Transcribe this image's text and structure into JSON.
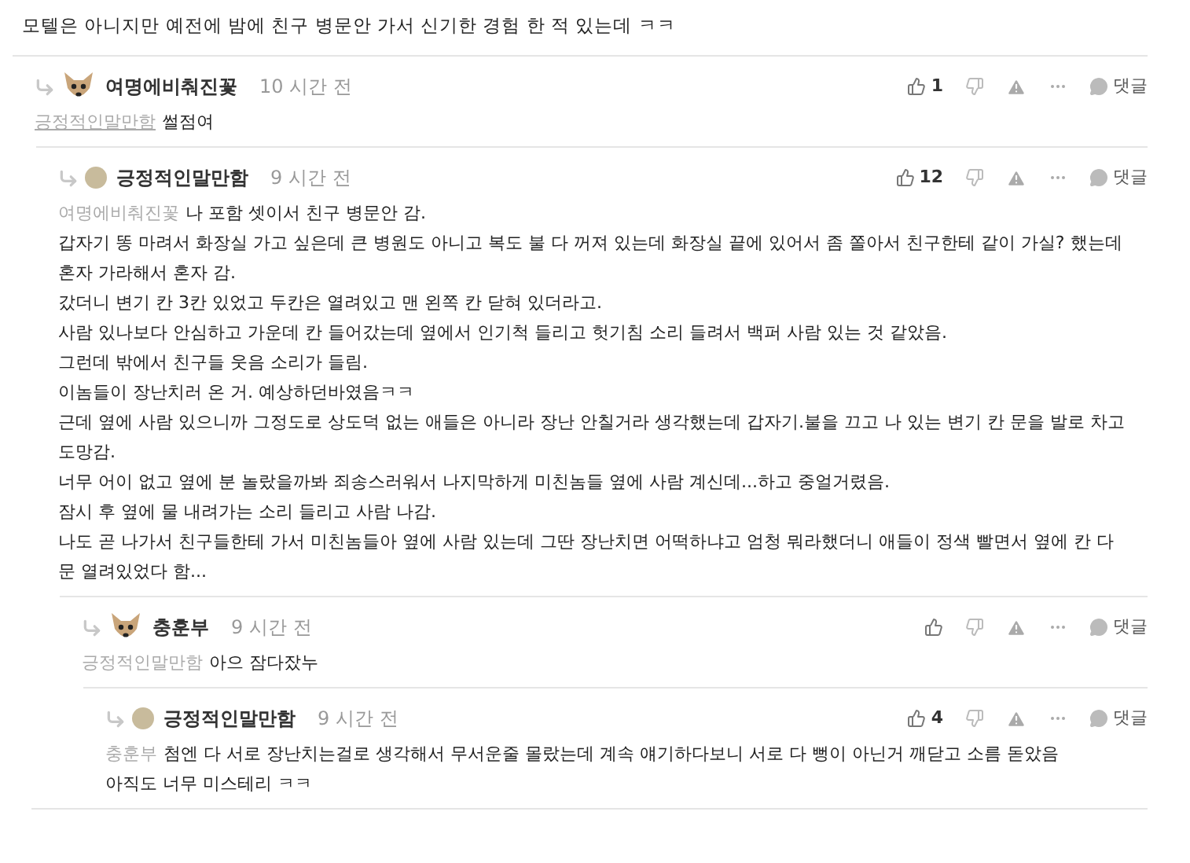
{
  "top_comment": {
    "body": "모텔은 아니지만 예전에 밤에 친구 병문안 가서 신기한 경험 한 적 있는데 ㅋㅋ"
  },
  "comments": [
    {
      "author": "여명에비춰진꽃",
      "kind": "dog",
      "time": "10 시간 전",
      "likes": "1",
      "reply_label": "댓글",
      "mention": "긍정적인말만함",
      "mention_underlined": true,
      "lines": [
        "썰점여"
      ],
      "children": [
        {
          "author": "긍정적인말만함",
          "kind": "circle",
          "time": "9 시간 전",
          "likes": "12",
          "reply_label": "댓글",
          "mention": "여명에비춰진꽃",
          "mention_underlined": false,
          "lines": [
            "나 포함 셋이서 친구 병문안 감.",
            "갑자기 똥 마려서 화장실 가고 싶은데 큰 병원도 아니고 복도 불 다 꺼져 있는데 화장실 끝에 있어서 좀 쫄아서 친구한테 같이 가실? 했는데 혼자 가라해서 혼자 감.",
            "갔더니 변기 칸 3칸 있었고 두칸은 열려있고 맨 왼쪽 칸 닫혀 있더라고.",
            "사람 있나보다 안심하고 가운데 칸 들어갔는데 옆에서 인기척 들리고 헛기침 소리 들려서 백퍼 사람 있는 것 같았음.",
            "그런데 밖에서 친구들 웃음 소리가 들림.",
            "이놈들이 장난치러 온 거. 예상하던바였음ㅋㅋ",
            "근데 옆에 사람 있으니까 그정도로 상도덕 없는 애들은 아니라 장난 안칠거라 생각했는데 갑자기.불을 끄고 나 있는 변기 칸 문을 발로 차고 도망감.",
            "너무 어이 없고 옆에 분 놀랐을까봐 죄송스러워서 나지막하게 미친놈들 옆에 사람 계신데...하고 중얼거렸음.",
            "잠시 후 옆에 물 내려가는 소리 들리고 사람 나감.",
            "나도 곧 나가서 친구들한테 가서 미친놈들아 옆에 사람 있는데 그딴 장난치면 어떡하냐고 엄청 뭐라했더니 애들이 정색 빨면서 옆에 칸 다 문 열려있었다 함..."
          ],
          "children": [
            {
              "author": "충훈부",
              "kind": "dog",
              "time": "9 시간 전",
              "reply_label": "댓글",
              "mention": "긍정적인말만함",
              "mention_underlined": false,
              "lines": [
                "아으 잠다잤누"
              ],
              "children": [
                {
                  "author": "긍정적인말만함",
                  "kind": "circle",
                  "time": "9 시간 전",
                  "likes": "4",
                  "reply_label": "댓글",
                  "mention": "충훈부",
                  "mention_underlined": false,
                  "lines": [
                    "첨엔 다 서로 장난치는걸로 생각해서 무서운줄 몰랐는데 계속 얘기하다보니 서로 다 뻥이 아닌거 깨닫고 소름 돋았음",
                    "아직도 너무 미스테리 ㅋㅋ"
                  ]
                }
              ]
            }
          ]
        }
      ]
    }
  ]
}
